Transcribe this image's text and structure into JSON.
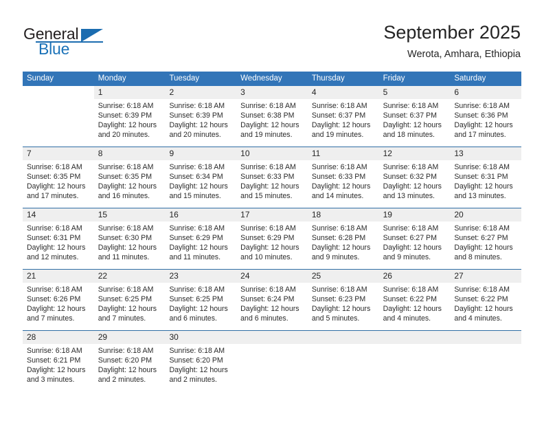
{
  "brand": {
    "word_one": "General",
    "word_two": "Blue",
    "accent_color": "#1b6cb0"
  },
  "header": {
    "title": "September 2025",
    "subtitle": "Werota, Amhara, Ethiopia"
  },
  "theme": {
    "header_blue": "#3275b8",
    "rule_blue": "#2e6da4",
    "date_band_gray": "#efefef"
  },
  "weekdays": [
    "Sunday",
    "Monday",
    "Tuesday",
    "Wednesday",
    "Thursday",
    "Friday",
    "Saturday"
  ],
  "weeks": [
    [
      {
        "day": "",
        "lines": []
      },
      {
        "day": "1",
        "lines": [
          "Sunrise: 6:18 AM",
          "Sunset: 6:39 PM",
          "Daylight: 12 hours",
          "and 20 minutes."
        ]
      },
      {
        "day": "2",
        "lines": [
          "Sunrise: 6:18 AM",
          "Sunset: 6:39 PM",
          "Daylight: 12 hours",
          "and 20 minutes."
        ]
      },
      {
        "day": "3",
        "lines": [
          "Sunrise: 6:18 AM",
          "Sunset: 6:38 PM",
          "Daylight: 12 hours",
          "and 19 minutes."
        ]
      },
      {
        "day": "4",
        "lines": [
          "Sunrise: 6:18 AM",
          "Sunset: 6:37 PM",
          "Daylight: 12 hours",
          "and 19 minutes."
        ]
      },
      {
        "day": "5",
        "lines": [
          "Sunrise: 6:18 AM",
          "Sunset: 6:37 PM",
          "Daylight: 12 hours",
          "and 18 minutes."
        ]
      },
      {
        "day": "6",
        "lines": [
          "Sunrise: 6:18 AM",
          "Sunset: 6:36 PM",
          "Daylight: 12 hours",
          "and 17 minutes."
        ]
      }
    ],
    [
      {
        "day": "7",
        "lines": [
          "Sunrise: 6:18 AM",
          "Sunset: 6:35 PM",
          "Daylight: 12 hours",
          "and 17 minutes."
        ]
      },
      {
        "day": "8",
        "lines": [
          "Sunrise: 6:18 AM",
          "Sunset: 6:35 PM",
          "Daylight: 12 hours",
          "and 16 minutes."
        ]
      },
      {
        "day": "9",
        "lines": [
          "Sunrise: 6:18 AM",
          "Sunset: 6:34 PM",
          "Daylight: 12 hours",
          "and 15 minutes."
        ]
      },
      {
        "day": "10",
        "lines": [
          "Sunrise: 6:18 AM",
          "Sunset: 6:33 PM",
          "Daylight: 12 hours",
          "and 15 minutes."
        ]
      },
      {
        "day": "11",
        "lines": [
          "Sunrise: 6:18 AM",
          "Sunset: 6:33 PM",
          "Daylight: 12 hours",
          "and 14 minutes."
        ]
      },
      {
        "day": "12",
        "lines": [
          "Sunrise: 6:18 AM",
          "Sunset: 6:32 PM",
          "Daylight: 12 hours",
          "and 13 minutes."
        ]
      },
      {
        "day": "13",
        "lines": [
          "Sunrise: 6:18 AM",
          "Sunset: 6:31 PM",
          "Daylight: 12 hours",
          "and 13 minutes."
        ]
      }
    ],
    [
      {
        "day": "14",
        "lines": [
          "Sunrise: 6:18 AM",
          "Sunset: 6:31 PM",
          "Daylight: 12 hours",
          "and 12 minutes."
        ]
      },
      {
        "day": "15",
        "lines": [
          "Sunrise: 6:18 AM",
          "Sunset: 6:30 PM",
          "Daylight: 12 hours",
          "and 11 minutes."
        ]
      },
      {
        "day": "16",
        "lines": [
          "Sunrise: 6:18 AM",
          "Sunset: 6:29 PM",
          "Daylight: 12 hours",
          "and 11 minutes."
        ]
      },
      {
        "day": "17",
        "lines": [
          "Sunrise: 6:18 AM",
          "Sunset: 6:29 PM",
          "Daylight: 12 hours",
          "and 10 minutes."
        ]
      },
      {
        "day": "18",
        "lines": [
          "Sunrise: 6:18 AM",
          "Sunset: 6:28 PM",
          "Daylight: 12 hours",
          "and 9 minutes."
        ]
      },
      {
        "day": "19",
        "lines": [
          "Sunrise: 6:18 AM",
          "Sunset: 6:27 PM",
          "Daylight: 12 hours",
          "and 9 minutes."
        ]
      },
      {
        "day": "20",
        "lines": [
          "Sunrise: 6:18 AM",
          "Sunset: 6:27 PM",
          "Daylight: 12 hours",
          "and 8 minutes."
        ]
      }
    ],
    [
      {
        "day": "21",
        "lines": [
          "Sunrise: 6:18 AM",
          "Sunset: 6:26 PM",
          "Daylight: 12 hours",
          "and 7 minutes."
        ]
      },
      {
        "day": "22",
        "lines": [
          "Sunrise: 6:18 AM",
          "Sunset: 6:25 PM",
          "Daylight: 12 hours",
          "and 7 minutes."
        ]
      },
      {
        "day": "23",
        "lines": [
          "Sunrise: 6:18 AM",
          "Sunset: 6:25 PM",
          "Daylight: 12 hours",
          "and 6 minutes."
        ]
      },
      {
        "day": "24",
        "lines": [
          "Sunrise: 6:18 AM",
          "Sunset: 6:24 PM",
          "Daylight: 12 hours",
          "and 6 minutes."
        ]
      },
      {
        "day": "25",
        "lines": [
          "Sunrise: 6:18 AM",
          "Sunset: 6:23 PM",
          "Daylight: 12 hours",
          "and 5 minutes."
        ]
      },
      {
        "day": "26",
        "lines": [
          "Sunrise: 6:18 AM",
          "Sunset: 6:22 PM",
          "Daylight: 12 hours",
          "and 4 minutes."
        ]
      },
      {
        "day": "27",
        "lines": [
          "Sunrise: 6:18 AM",
          "Sunset: 6:22 PM",
          "Daylight: 12 hours",
          "and 4 minutes."
        ]
      }
    ],
    [
      {
        "day": "28",
        "lines": [
          "Sunrise: 6:18 AM",
          "Sunset: 6:21 PM",
          "Daylight: 12 hours",
          "and 3 minutes."
        ]
      },
      {
        "day": "29",
        "lines": [
          "Sunrise: 6:18 AM",
          "Sunset: 6:20 PM",
          "Daylight: 12 hours",
          "and 2 minutes."
        ]
      },
      {
        "day": "30",
        "lines": [
          "Sunrise: 6:18 AM",
          "Sunset: 6:20 PM",
          "Daylight: 12 hours",
          "and 2 minutes."
        ]
      },
      {
        "day": "",
        "lines": []
      },
      {
        "day": "",
        "lines": []
      },
      {
        "day": "",
        "lines": []
      },
      {
        "day": "",
        "lines": []
      }
    ]
  ]
}
